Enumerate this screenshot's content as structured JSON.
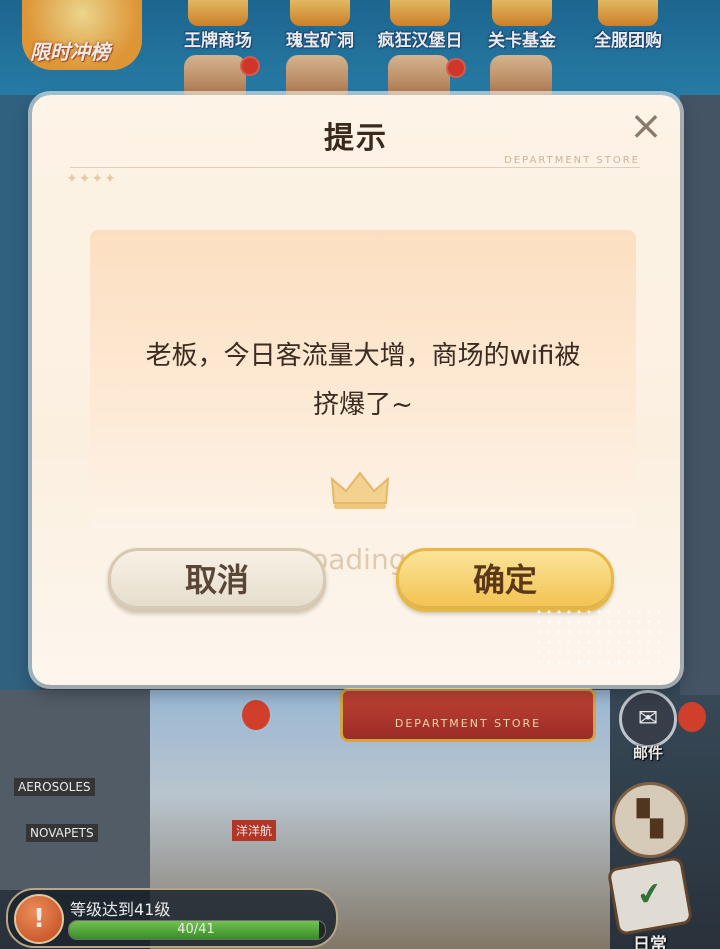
{
  "top_icons": [
    {
      "label": "王牌商场"
    },
    {
      "label": "瑰宝矿洞"
    },
    {
      "label": "疯狂汉堡日"
    },
    {
      "label": "关卡基金"
    },
    {
      "label": "全服团购"
    }
  ],
  "rank_badge": {
    "label": "限时冲榜"
  },
  "dialog": {
    "title": "提示",
    "close_label": "×",
    "subtitle": "DEPARTMENT STORE",
    "message_line1": "老板，今日客流量大增，商场的wifi被",
    "message_line2": "挤爆了~",
    "cancel_label": "取消",
    "confirm_label": "确定",
    "loading_text": "Loading..."
  },
  "scene": {
    "gate_sign": "DEPARTMENT STORE",
    "shop_signs": [
      "AEROSOLES",
      "NOVAPETS",
      "洋洋航"
    ]
  },
  "side_buttons": {
    "mail_label": "邮件",
    "daily_label": "日常"
  },
  "quest": {
    "title": "等级达到41级",
    "progress_text": "40/41",
    "progress_fraction": 0.976
  },
  "colors": {
    "confirm_gold": "#f2c24f",
    "cancel_cream": "#e5dccb",
    "text_dark": "#3b2b20",
    "progress_green": "#3c9a2a"
  }
}
